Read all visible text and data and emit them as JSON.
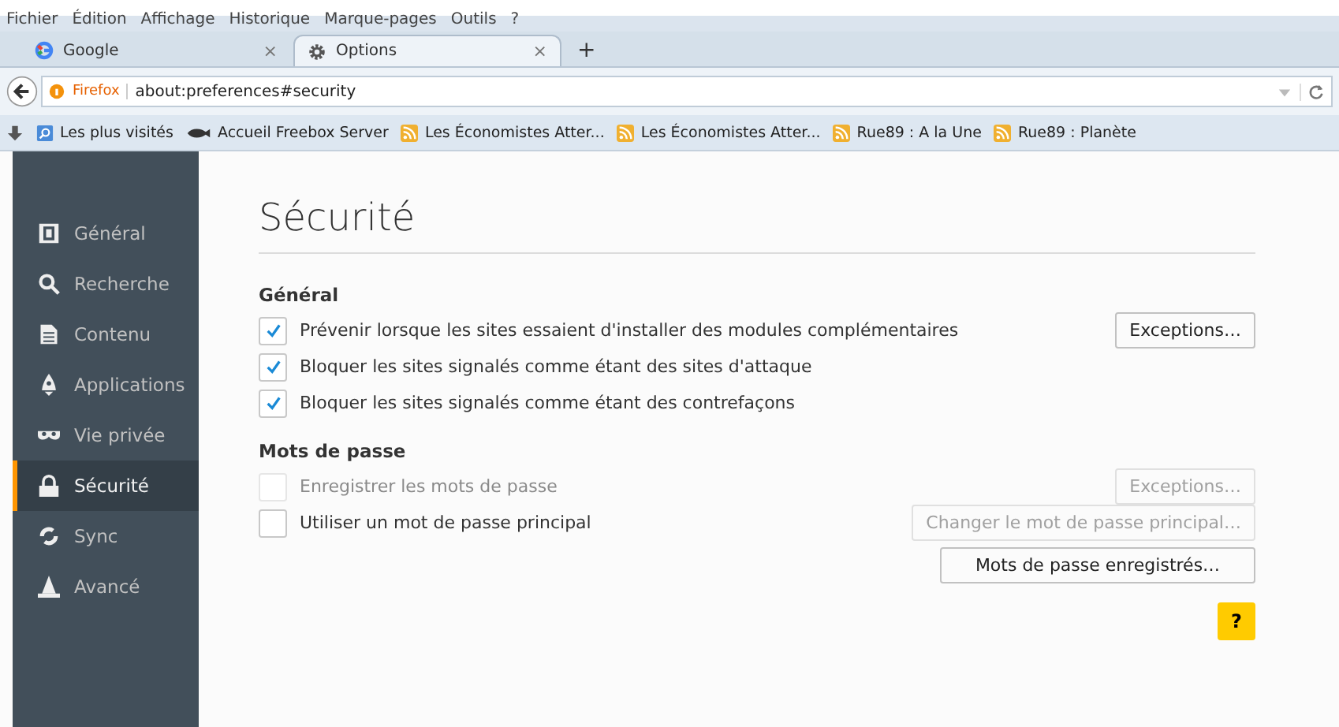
{
  "menu": [
    "Fichier",
    "Édition",
    "Affichage",
    "Historique",
    "Marque-pages",
    "Outils",
    "?"
  ],
  "tabs": [
    {
      "label": "Google",
      "selected": false,
      "kind": "google",
      "close": "×"
    },
    {
      "label": "Options",
      "selected": true,
      "kind": "gear",
      "close": "×"
    }
  ],
  "new_tab": "+",
  "address": {
    "identity": "Firefox",
    "value": "about:preferences#security"
  },
  "bookmarks": [
    {
      "label": "Les plus visités",
      "kind": "folder"
    },
    {
      "label": "Accueil Freebox Server",
      "kind": "freebox"
    },
    {
      "label": "Les Économistes Atter...",
      "kind": "feed"
    },
    {
      "label": "Les Économistes Atter...",
      "kind": "feed"
    },
    {
      "label": "Rue89 : A la Une",
      "kind": "feed"
    },
    {
      "label": "Rue89 : Planète",
      "kind": "feed"
    }
  ],
  "sidebar": {
    "items": [
      {
        "label": "Général",
        "selected": false
      },
      {
        "label": "Recherche",
        "selected": false
      },
      {
        "label": "Contenu",
        "selected": false
      },
      {
        "label": "Applications",
        "selected": false
      },
      {
        "label": "Vie privée",
        "selected": false
      },
      {
        "label": "Sécurité",
        "selected": true
      },
      {
        "label": "Sync",
        "selected": false
      },
      {
        "label": "Avancé",
        "selected": false
      }
    ]
  },
  "page": {
    "title": "Sécurité",
    "sections": [
      {
        "title": "Général",
        "rows": [
          {
            "label": "Prévenir lorsque les sites essaient d'installer des modules complémentaires",
            "checked": true,
            "disabled": false,
            "buttons": [
              {
                "label": "Exceptions…",
                "disabled": false
              }
            ]
          },
          {
            "label": "Bloquer les sites signalés comme étant des sites d'attaque",
            "checked": true,
            "disabled": false,
            "buttons": []
          },
          {
            "label": "Bloquer les sites signalés comme étant des contrefaçons",
            "checked": true,
            "disabled": false,
            "buttons": []
          }
        ]
      },
      {
        "title": "Mots de passe",
        "rows": [
          {
            "label": "Enregistrer les mots de passe",
            "checked": false,
            "disabled": true,
            "buttons": [
              {
                "label": "Exceptions…",
                "disabled": true
              }
            ]
          },
          {
            "label": "Utiliser un mot de passe principal",
            "checked": false,
            "disabled": false,
            "buttons": [
              {
                "label": "Changer le mot de passe principal…",
                "disabled": true
              }
            ]
          }
        ],
        "extra_buttons": [
          {
            "label": "Mots de passe enregistrés…",
            "disabled": false
          }
        ]
      }
    ],
    "help": "?"
  }
}
